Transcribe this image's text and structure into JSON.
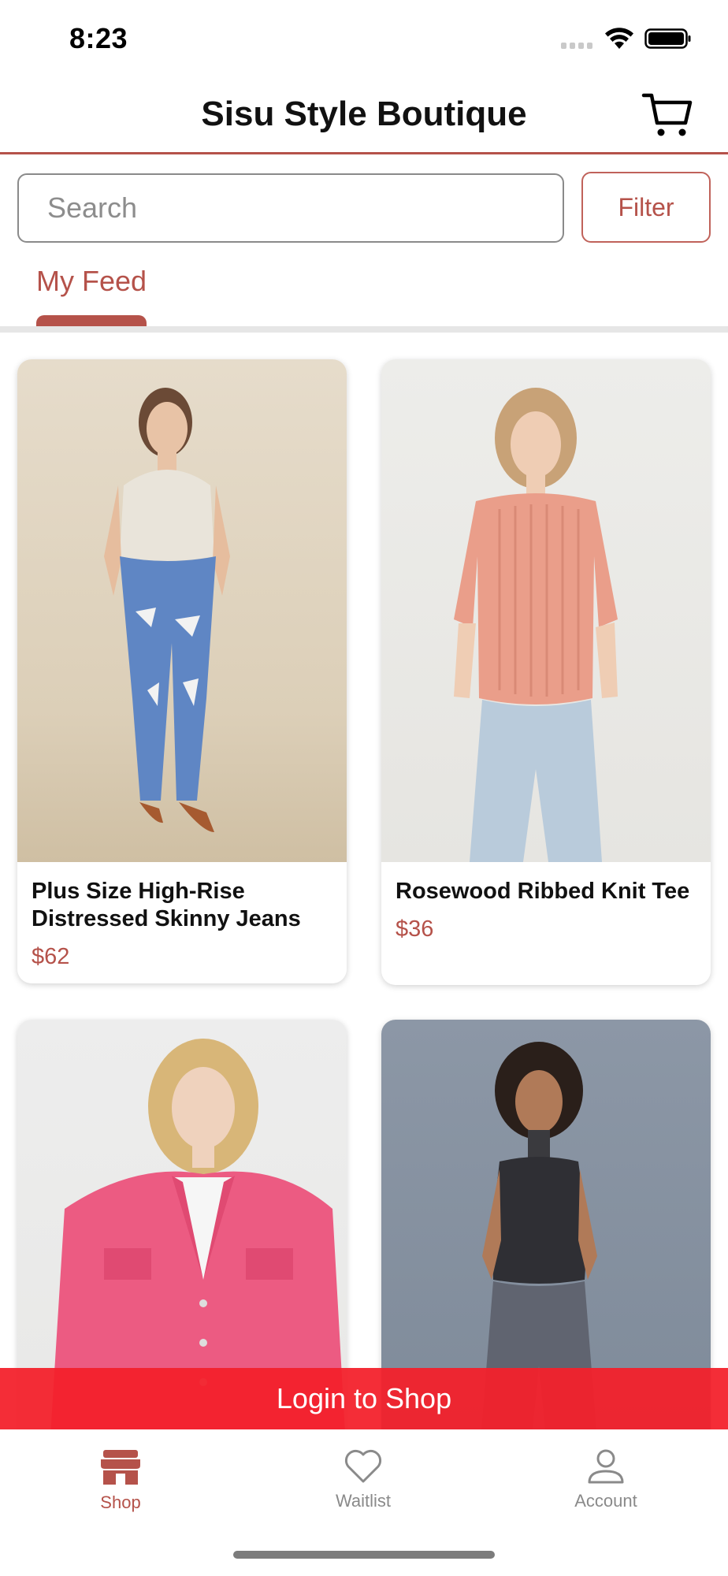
{
  "status_bar": {
    "time": "8:23"
  },
  "header": {
    "title": "Sisu Style Boutique",
    "cart_icon": "cart-icon"
  },
  "search": {
    "placeholder": "Search",
    "value": ""
  },
  "filter": {
    "label": "Filter"
  },
  "tabs": [
    {
      "label": "My Feed",
      "active": true
    }
  ],
  "colors": {
    "accent": "#b5524a",
    "login_banner": "#f3202a",
    "tab_inactive": "#8a8a8a"
  },
  "products": [
    {
      "name": "Plus Size High-Rise Distressed Skinny Jeans",
      "price": "$62"
    },
    {
      "name": "Rosewood Ribbed Knit Tee",
      "price": "$36"
    },
    {
      "name": "",
      "price": ""
    },
    {
      "name": "",
      "price": ""
    }
  ],
  "login_banner": {
    "label": "Login to Shop"
  },
  "tabbar": {
    "items": [
      {
        "label": "Shop",
        "icon": "storefront-icon",
        "active": true
      },
      {
        "label": "Waitlist",
        "icon": "heart-icon",
        "active": false
      },
      {
        "label": "Account",
        "icon": "person-icon",
        "active": false
      }
    ]
  }
}
